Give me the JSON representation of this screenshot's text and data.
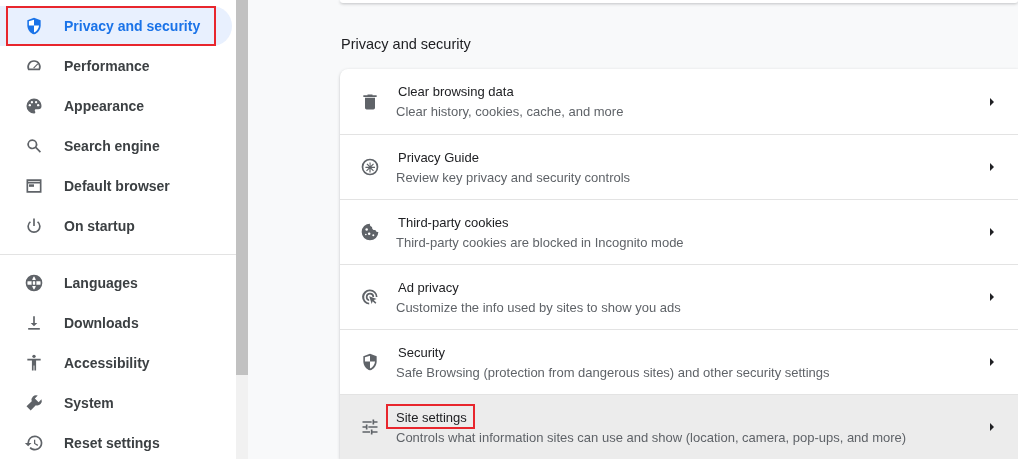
{
  "sidebar": {
    "groups": [
      {
        "items": [
          {
            "label": "Privacy and security",
            "kind": "shield",
            "selected": true,
            "highlighted": true
          },
          {
            "label": "Performance",
            "kind": "gauge",
            "selected": false,
            "highlighted": false
          },
          {
            "label": "Appearance",
            "kind": "palette",
            "selected": false,
            "highlighted": false
          },
          {
            "label": "Search engine",
            "kind": "search",
            "selected": false,
            "highlighted": false
          },
          {
            "label": "Default browser",
            "kind": "browser",
            "selected": false,
            "highlighted": false
          },
          {
            "label": "On startup",
            "kind": "power",
            "selected": false,
            "highlighted": false
          }
        ]
      },
      {
        "items": [
          {
            "label": "Languages",
            "kind": "globe",
            "selected": false,
            "highlighted": false
          },
          {
            "label": "Downloads",
            "kind": "download",
            "selected": false,
            "highlighted": false
          },
          {
            "label": "Accessibility",
            "kind": "person",
            "selected": false,
            "highlighted": false
          },
          {
            "label": "System",
            "kind": "wrench",
            "selected": false,
            "highlighted": false
          },
          {
            "label": "Reset settings",
            "kind": "history",
            "selected": false,
            "highlighted": false
          }
        ]
      }
    ]
  },
  "section": {
    "heading": "Privacy and security",
    "rows": [
      {
        "title": "Clear browsing data",
        "subtitle": "Clear history, cookies, cache, and more",
        "kind": "trash",
        "hovered": false,
        "highlighted": false
      },
      {
        "title": "Privacy Guide",
        "subtitle": "Review key privacy and security controls",
        "kind": "compass",
        "hovered": false,
        "highlighted": false
      },
      {
        "title": "Third-party cookies",
        "subtitle": "Third-party cookies are blocked in Incognito mode",
        "kind": "cookie",
        "hovered": false,
        "highlighted": false
      },
      {
        "title": "Ad privacy",
        "subtitle": "Customize the info used by sites to show you ads",
        "kind": "adprivacy",
        "hovered": false,
        "highlighted": false
      },
      {
        "title": "Security",
        "subtitle": "Safe Browsing (protection from dangerous sites) and other security settings",
        "kind": "shield",
        "hovered": false,
        "highlighted": false
      },
      {
        "title": "Site settings",
        "subtitle": "Controls what information sites can use and show (location, camera, pop-ups, and more)",
        "kind": "sliders",
        "hovered": true,
        "highlighted": true
      }
    ]
  }
}
